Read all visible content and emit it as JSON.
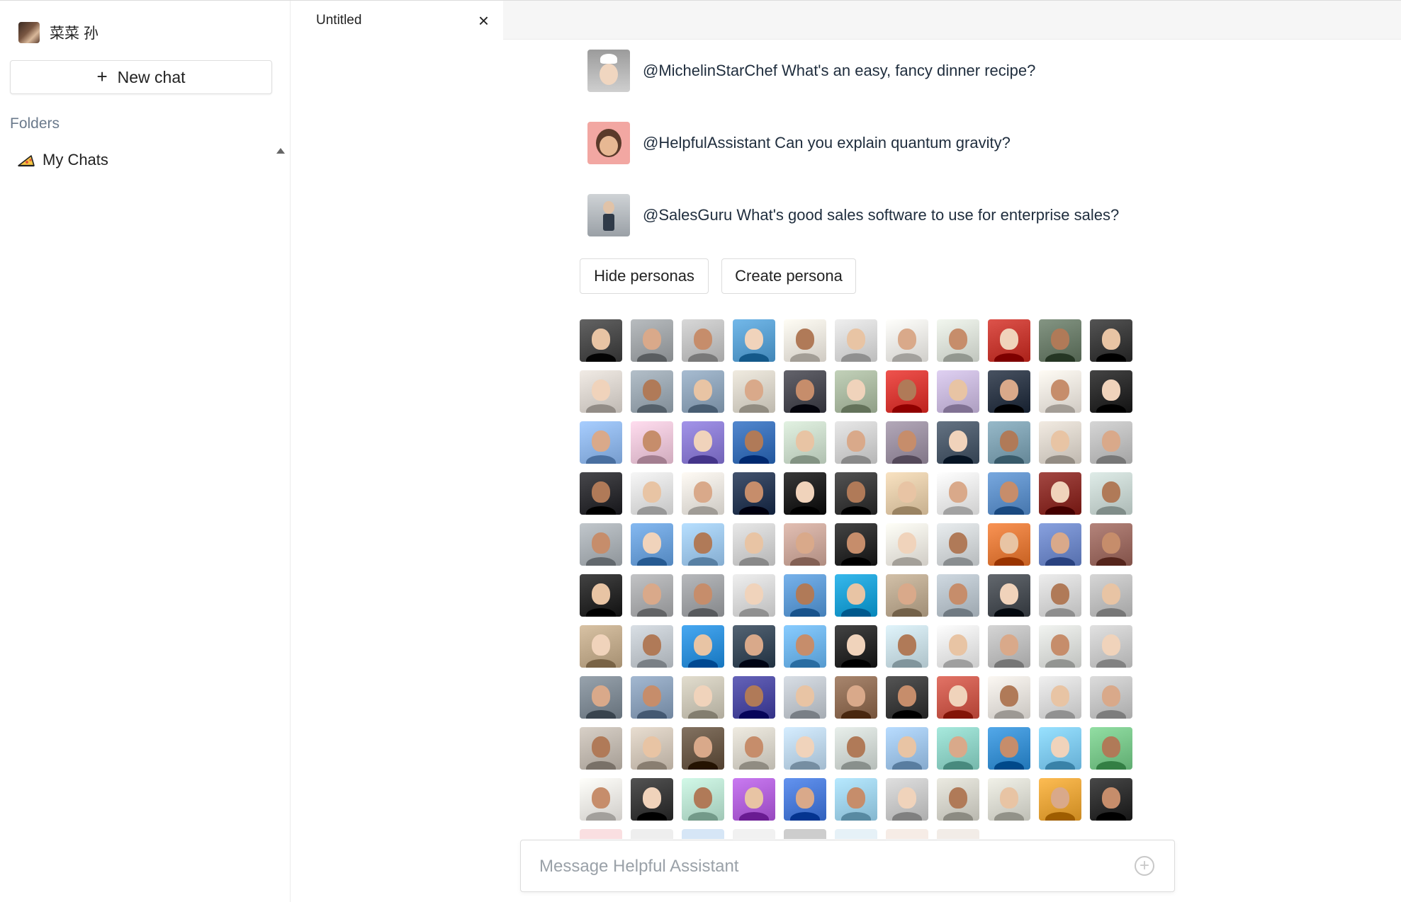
{
  "sidebar": {
    "user_name": "菜菜 孙",
    "new_chat_label": "New chat",
    "folders_label": "Folders",
    "folders": [
      {
        "label": "My Chats",
        "icon": "pizza-slice-icon"
      }
    ]
  },
  "tabs": [
    {
      "title": "Untitled"
    }
  ],
  "prompts": [
    {
      "text": "@MichelinStarChef What's an easy, fancy dinner recipe?",
      "avatar": "chef-avatar"
    },
    {
      "text": "@HelpfulAssistant Can you explain quantum gravity?",
      "avatar": "assistant-avatar"
    },
    {
      "text": "@SalesGuru What's good sales software to use for enterprise sales?",
      "avatar": "sales-avatar"
    }
  ],
  "buttons": {
    "hide_personas": "Hide personas",
    "create_persona": "Create persona"
  },
  "persona_colors": [
    [
      "#4a4a4a",
      "#9fa3a6",
      "#bfbfbf",
      "#5a9fd0",
      "#e9e4dc",
      "#d6d6d6",
      "#e9e7e3",
      "#d9ded6",
      "#c43a32",
      "#6b7c6a",
      "#3b3b3b"
    ],
    [
      "#d8d2cc",
      "#9aa6b0",
      "#8ea3b8",
      "#d7d2c7",
      "#4a4a52",
      "#a9b8a0",
      "#d63a35",
      "#c6b7d9",
      "#2f3948",
      "#e9e3dc",
      "#2b2b2b"
    ],
    [
      "#8fb5e6",
      "#e9c4d6",
      "#8a7bd0",
      "#3a6fb6",
      "#c9d9c9",
      "#cfcfcf",
      "#9a8fa0",
      "#4c5a6a",
      "#7ea0b0",
      "#d9d2c9",
      "#bdbdbd"
    ],
    [
      "#2f2f33",
      "#dedede",
      "#e6e2dc",
      "#2a3a55",
      "#202020",
      "#3a3a3a",
      "#e0c9a8",
      "#e8e8e8",
      "#5f8fc6",
      "#8a2f2a",
      "#c6d3cf"
    ],
    [
      "#a8aeb3",
      "#6ca0d8",
      "#9ec6ea",
      "#cfcfcf",
      "#c9a69a",
      "#2b2b2b",
      "#eae6df",
      "#d0d4d6",
      "#e07a3b",
      "#6f88c6",
      "#9b6b62"
    ],
    [
      "#2a2a2a",
      "#a9aaac",
      "#9ea0a3",
      "#d6d6d6",
      "#5e99d2",
      "#1e9fd3",
      "#b9a78f",
      "#b6c0c8",
      "#4a4f55",
      "#d4d4d4",
      "#bdbdbd"
    ],
    [
      "#bfa98b",
      "#c0c6cc",
      "#2f8fd8",
      "#3a4a5a",
      "#6fb3e8",
      "#2a2a2a",
      "#c7dbe2",
      "#e5e5e5",
      "#bcbcbc",
      "#d9dbd8",
      "#c8c8c8"
    ],
    [
      "#7f8a94",
      "#8a9fb8",
      "#c9c4b5",
      "#4c4aa0",
      "#bfc5cc",
      "#8f6d55",
      "#3c3c3c",
      "#c95a4d",
      "#e3dfda",
      "#d7d7d7",
      "#c3c3c3"
    ],
    [
      "#bfb7ae",
      "#cfc4b7",
      "#6a5948",
      "#d6d2c8",
      "#bcd4e8",
      "#cfd6d2",
      "#9fc3e6",
      "#8ed0c4",
      "#3a8fd0",
      "#7fc8ee",
      "#79c58a"
    ],
    [
      "#e9e6e2",
      "#3a3a3a",
      "#b9e0cf",
      "#b061d8",
      "#4a7ad6",
      "#9ed0e8",
      "#c6c6c6",
      "#d2d1c8",
      "#d8d8cf",
      "#e4a33a",
      "#2f2f2f"
    ]
  ],
  "faded_row_colors": [
    "#f0a3a8",
    "#cfcfcf",
    "#8ab8e6",
    "#d6d6d6",
    "#707070",
    "#b8d8e8",
    "#e6c9b8",
    "#d9c9b9"
  ],
  "composer": {
    "placeholder": "Message Helpful Assistant"
  }
}
